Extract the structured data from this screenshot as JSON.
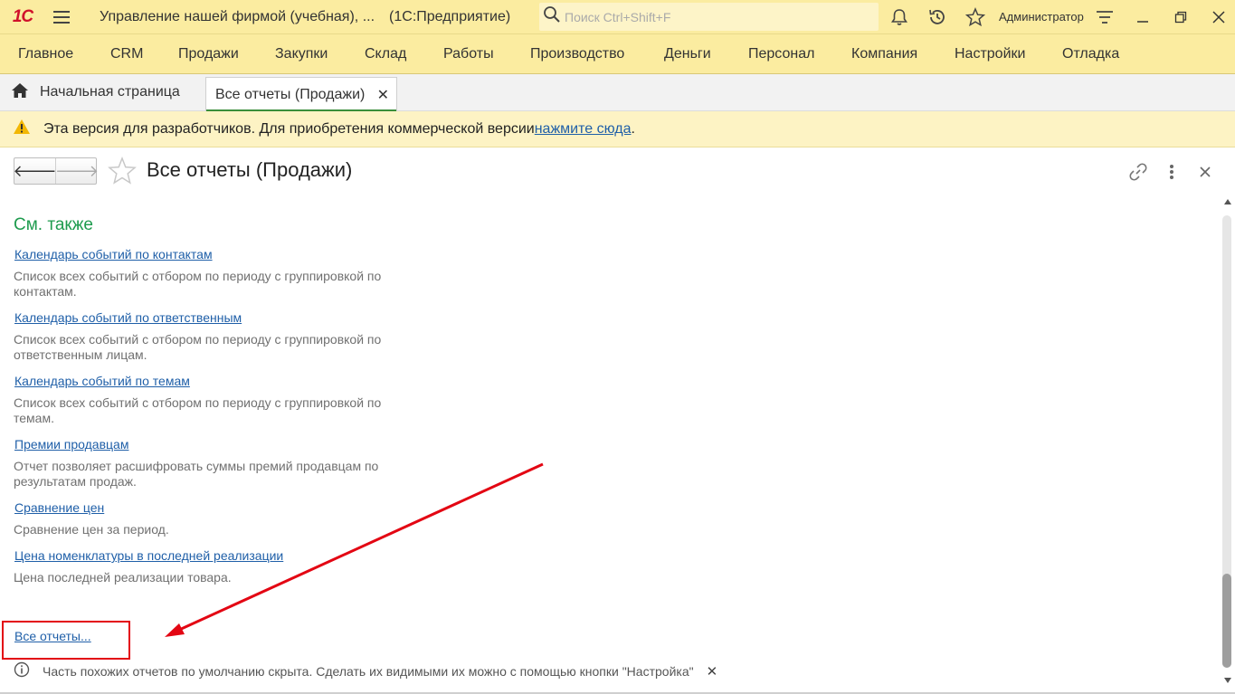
{
  "titlebar": {
    "logo": "1С",
    "app_title": "Управление нашей фирмой (учебная), ...",
    "app_sub": "(1С:Предприятие)",
    "search_placeholder": "Поиск Ctrl+Shift+F",
    "user": "Администратор"
  },
  "main_menu": [
    "Главное",
    "CRM",
    "Продажи",
    "Закупки",
    "Склад",
    "Работы",
    "Производство",
    "Деньги",
    "Персонал",
    "Компания",
    "Настройки",
    "Отладка"
  ],
  "tabs": {
    "home": "Начальная страница",
    "active": "Все отчеты (Продажи)"
  },
  "banner": {
    "text": "Эта версия для разработчиков. Для приобретения коммерческой версии ",
    "link": "нажмите сюда",
    "tail": "."
  },
  "form": {
    "title": "Все отчеты (Продажи)"
  },
  "content": {
    "section_title": "См. также",
    "reports": [
      {
        "title": "Календарь событий по контактам",
        "description": "Список всех событий с отбором по периоду с группировкой по контактам."
      },
      {
        "title": "Календарь событий по ответственным",
        "description": "Список всех событий с отбором по периоду с группировкой по ответственным лицам."
      },
      {
        "title": "Календарь событий по темам",
        "description": "Список всех событий с отбором по периоду с группировкой по темам."
      },
      {
        "title": "Премии продавцам",
        "description": "Отчет позволяет расшифровать суммы премий продавцам по результатам продаж."
      },
      {
        "title": "Сравнение цен",
        "description": "Сравнение цен за период."
      },
      {
        "title": "Цена номенклатуры в последней реализации",
        "description": "Цена последней реализации товара."
      }
    ],
    "all_reports_link": "Все отчеты...",
    "info_text": "Часть похожих отчетов по умолчанию скрыта. Сделать их видимыми их можно с помощью кнопки \"Настройка\""
  },
  "colors": {
    "accent_yellow": "#fbeca0",
    "link_blue": "#1f5fa8",
    "section_green": "#1e9b4e",
    "annotation_red": "#e30613"
  }
}
